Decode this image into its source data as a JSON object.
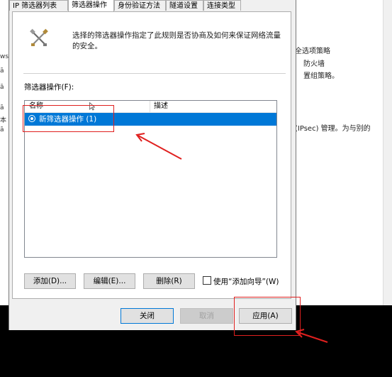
{
  "background": {
    "left_texts": [
      "ws",
      "ā",
      "ā",
      "ā",
      "本",
      "ā"
    ],
    "right_texts": [
      "全选项策略",
      "防火墙",
      "置组策略。",
      "(IPsec) 管理。为与别的"
    ]
  },
  "dialog": {
    "tabs": [
      "IP 筛选器列表",
      "筛选器操作",
      "身份验证方法",
      "隧道设置",
      "连接类型"
    ],
    "description": "选择的筛选器操作指定了此规则是否协商及如何来保证网络流量的安全。",
    "filter_action_label": "筛选器操作(F):",
    "list": {
      "columns": [
        "名称",
        "描述"
      ],
      "rows": [
        {
          "name": "新筛选器操作 (1)",
          "description": "",
          "selected": true
        }
      ]
    },
    "buttons": {
      "add": "添加(D)...",
      "edit": "编辑(E)...",
      "delete": "删除(R)",
      "use_wizard": "使用“添加向导”(W)",
      "close": "关闭",
      "cancel": "取消",
      "apply": "应用(A)"
    }
  },
  "colors": {
    "selection": "#0078d7",
    "annotation": "#e0201f"
  }
}
